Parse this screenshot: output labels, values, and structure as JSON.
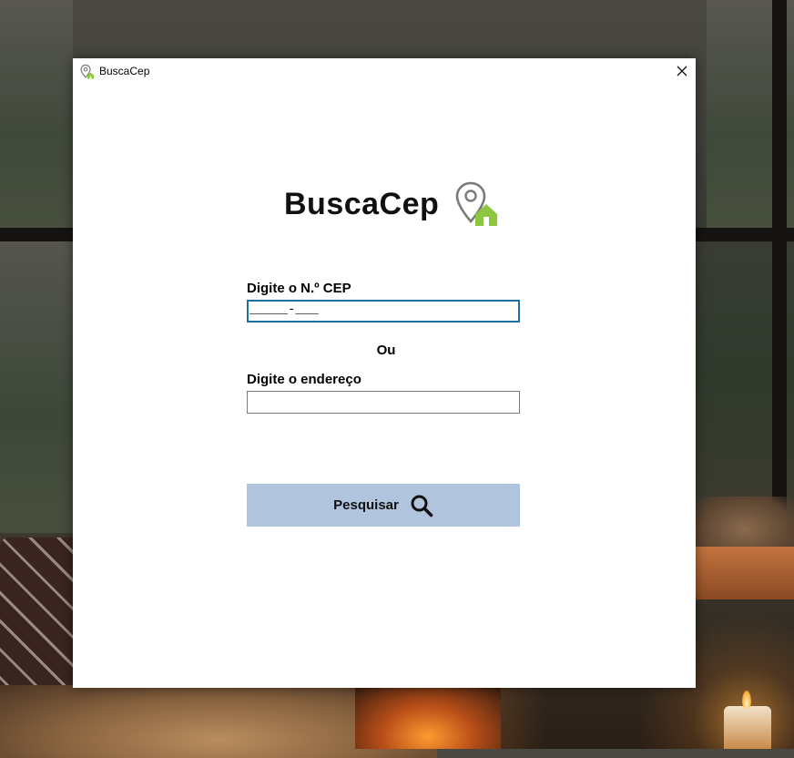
{
  "window": {
    "title": "BuscaCep",
    "close_icon": "close-icon"
  },
  "logo": {
    "text": "BuscaCep",
    "icon": "location-pin-house-icon",
    "icon_colors": {
      "pin": "#7a7a7a",
      "house": "#8dc63f"
    }
  },
  "form": {
    "cep_label": "Digite o N.º CEP",
    "cep_mask": "_____-___",
    "cep_value": "",
    "separator": "Ou",
    "address_label": "Digite o endereço",
    "address_value": ""
  },
  "search_button": {
    "label": "Pesquisar",
    "icon": "search-icon",
    "background": "#b0c4de"
  }
}
